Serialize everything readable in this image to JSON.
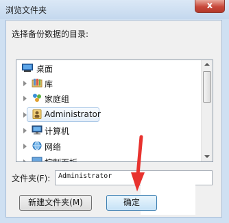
{
  "window": {
    "title": "浏览文件夹",
    "close_label": "x"
  },
  "dialog": {
    "prompt": "选择备份数据的目录:"
  },
  "tree": {
    "items": [
      {
        "label": "桌面",
        "icon": "desktop-icon",
        "expanded": false
      },
      {
        "label": "库",
        "icon": "library-icon"
      },
      {
        "label": "家庭组",
        "icon": "homegroup-icon"
      },
      {
        "label": "Administrator",
        "icon": "user-icon",
        "selected": true
      },
      {
        "label": "计算机",
        "icon": "computer-icon"
      },
      {
        "label": "网络",
        "icon": "network-icon"
      },
      {
        "label": "控制面板",
        "icon": "control-panel-icon"
      }
    ]
  },
  "folder": {
    "label": "文件夹(F):",
    "value": "Administrator"
  },
  "buttons": {
    "new_folder": "新建文件夹(M)",
    "ok": "确定"
  },
  "colors": {
    "annotation_arrow": "#e8322e",
    "selection_bg": "#e4eef9"
  }
}
